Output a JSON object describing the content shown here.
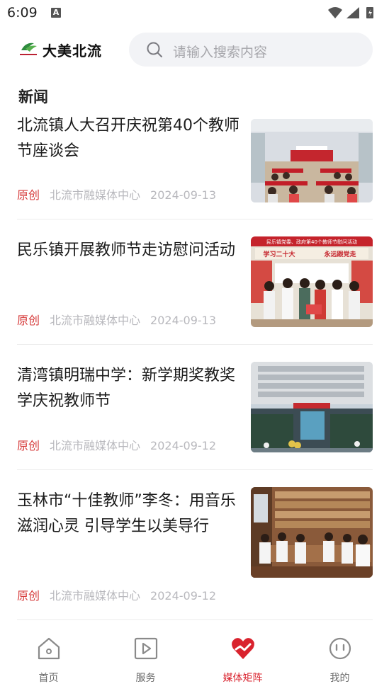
{
  "status_bar": {
    "time": "6:09",
    "notification": "A"
  },
  "header": {
    "app_title": "大美北流",
    "search_placeholder": "请输入搜索内容",
    "logo_text": "大美北流"
  },
  "section": {
    "title": "新闻"
  },
  "articles": [
    {
      "title": "北流镇人大召开庆祝第40个教师节座谈会",
      "tag": "原创",
      "source": "北流市融媒体中心",
      "date": "2024-09-13",
      "image_banner": ""
    },
    {
      "title": "民乐镇开展教师节走访慰问活动",
      "tag": "原创",
      "source": "北流市融媒体中心",
      "date": "2024-09-13",
      "image_banner": "民乐镇党委、政府第40个教师节慰问活动",
      "image_slogans": [
        "学习二十大",
        "永远跟党走"
      ]
    },
    {
      "title": "清湾镇明瑞中学：新学期奖教奖学庆祝教师节",
      "tag": "原创",
      "source": "北流市融媒体中心",
      "date": "2024-09-12"
    },
    {
      "title": "玉林市“十佳教师”李冬：用音乐滋润心灵 引导学生以美导行",
      "tag": "原创",
      "source": "北流市融媒体中心",
      "date": "2024-09-12"
    }
  ],
  "tabbar": {
    "tabs": [
      {
        "label": "首页",
        "icon": "home-icon"
      },
      {
        "label": "服务",
        "icon": "play-icon"
      },
      {
        "label": "媒体矩阵",
        "icon": "heart-icon"
      },
      {
        "label": "我的",
        "icon": "face-icon"
      }
    ],
    "active_index": 2,
    "active_color": "#d9232e"
  }
}
